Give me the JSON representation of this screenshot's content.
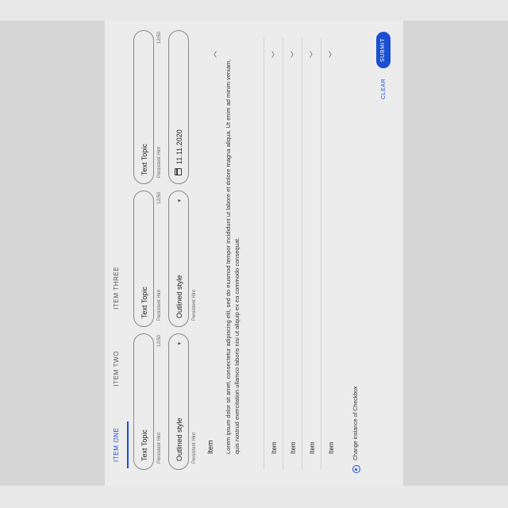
{
  "tabs": [
    "ITEM ONE",
    "ITEM TWO",
    "ITEM THREE"
  ],
  "fields_row1": [
    {
      "value": "Text Topic",
      "hint": "Persistent Hint",
      "count": "12/50"
    },
    {
      "value": "Text Topic",
      "hint": "Persistent Hint",
      "count": "12/50"
    },
    {
      "value": "Text Topic",
      "hint": "Persistent Hint",
      "count": "12/50"
    }
  ],
  "fields_row2": [
    {
      "value": "Outlined style",
      "arrow": "▾",
      "hint": "Persistent Hint"
    },
    {
      "value": "Outlined style",
      "arrow": "▾",
      "hint": "Persistent Hint"
    },
    {
      "value": "11.11.2020"
    }
  ],
  "list": {
    "title": "Item",
    "body": "Lorem ipsum dolor sit amet, consectetur adipiscing elit, sed do eiusmod tempor incididunt ut labore et dolore magna aliqua. Ut enim ad minim veniam, quis nostrud exercitation ullamco laboris nisi ut aliquip ex ea commodo consequat.",
    "rows": [
      "Item",
      "Item",
      "Item",
      "Item"
    ]
  },
  "checkbox_label": "Change instance of Checkbox",
  "buttons": {
    "clear": "CLEAR",
    "submit": "SUBMIT"
  },
  "colors": {
    "accent": "#1b4fd1"
  }
}
